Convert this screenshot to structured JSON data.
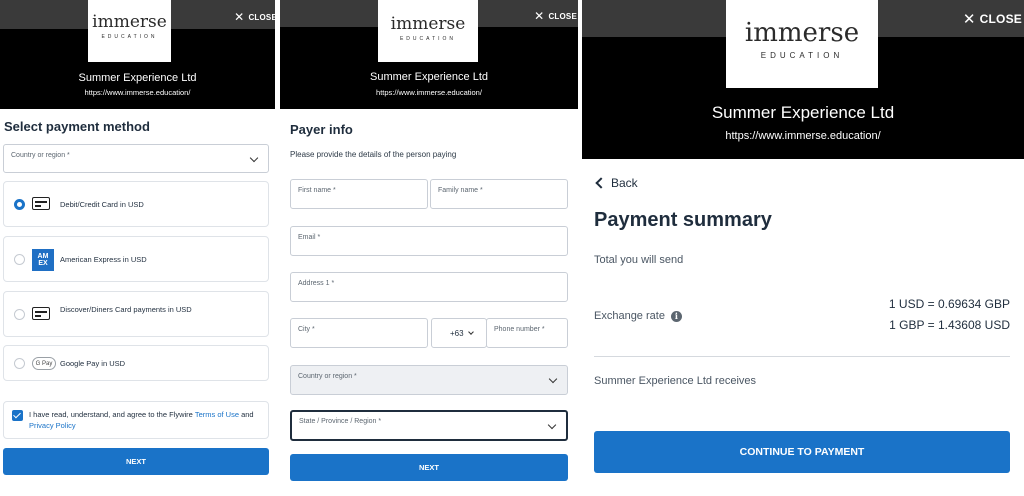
{
  "shared": {
    "close_label": "CLOSE",
    "logo_main": "immerse",
    "logo_sub": "EDUCATION",
    "merchant_name": "Summer Experience Ltd",
    "merchant_url": "https://www.immerse.education/"
  },
  "payment_method": {
    "title": "Select payment method",
    "country_label": "Country or region *",
    "options": [
      {
        "label": "Debit/Credit Card in USD",
        "icon": "credit-card-icon",
        "selected": true
      },
      {
        "label": "American Express in USD",
        "icon": "amex-icon",
        "icon_text": "AM EX",
        "selected": false
      },
      {
        "label": "Discover/Diners Card payments in USD",
        "icon": "credit-card-icon",
        "selected": false
      },
      {
        "label": "Google Pay in USD",
        "icon": "google-pay-icon",
        "icon_text": "G Pay",
        "selected": false
      }
    ],
    "terms_prefix": "I have read, understand, and agree to the Flywire",
    "terms_link": "Terms of Use",
    "terms_and": "and",
    "privacy_link": "Privacy Policy",
    "terms_checked": true,
    "next_label": "NEXT"
  },
  "payer_info": {
    "title": "Payer info",
    "subtitle": "Please provide the details of the person paying",
    "first_name_label": "First name *",
    "family_name_label": "Family name *",
    "email_label": "Email *",
    "address_label": "Address 1 *",
    "city_label": "City *",
    "phone_code": "+63",
    "phone_label": "Phone number *",
    "country_label": "Country or region *",
    "state_label": "State / Province / Region *",
    "next_label": "NEXT"
  },
  "summary": {
    "back_label": "Back",
    "title": "Payment summary",
    "total_label": "Total you will send",
    "exchange_label": "Exchange rate",
    "rate_line1": "1 USD = 0.69634 GBP",
    "rate_line2": "1 GBP = 1.43608 USD",
    "receives_label": "Summer Experience Ltd receives",
    "continue_label": "CONTINUE TO PAYMENT"
  },
  "colors": {
    "accent": "#1a73c8",
    "header_bg": "#000000",
    "overlay_bg": "#3a3a3a"
  }
}
